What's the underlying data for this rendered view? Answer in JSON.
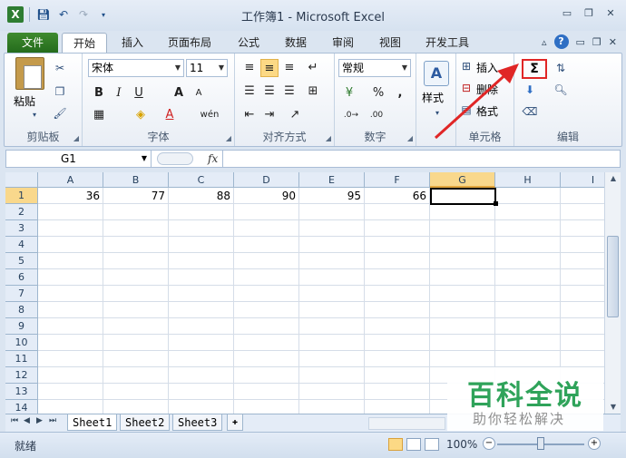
{
  "window": {
    "title": "工作簿1 - Microsoft Excel"
  },
  "ribbon_tabs": [
    {
      "label": "文件"
    },
    {
      "label": "开始"
    },
    {
      "label": "插入"
    },
    {
      "label": "页面布局"
    },
    {
      "label": "公式"
    },
    {
      "label": "数据"
    },
    {
      "label": "审阅"
    },
    {
      "label": "视图"
    },
    {
      "label": "开发工具"
    }
  ],
  "clipboard": {
    "paste_label": "粘贴",
    "group_label": "剪贴板"
  },
  "font": {
    "name": "宋体",
    "size": "11",
    "group_label": "字体",
    "bold": "B",
    "italic": "I",
    "underline": "U",
    "grow": "A",
    "shrink": "A",
    "font_color": "A",
    "phonetic": "wén"
  },
  "alignment": {
    "group_label": "对齐方式"
  },
  "number": {
    "format": "常规",
    "group_label": "数字",
    "percent": "%",
    "comma": ","
  },
  "styles": {
    "label": "样式"
  },
  "cells": {
    "insert": "插入",
    "delete": "删除",
    "format": "格式",
    "group_label": "单元格"
  },
  "editing": {
    "autosum": "Σ",
    "group_label": "编辑"
  },
  "formula_bar": {
    "name_box": "G1",
    "fx": "fx",
    "formula": ""
  },
  "columns": [
    "A",
    "B",
    "C",
    "D",
    "E",
    "F",
    "G",
    "H",
    "I"
  ],
  "rows": [
    "1",
    "2",
    "3",
    "4",
    "5",
    "6",
    "7",
    "8",
    "9",
    "10",
    "11",
    "12",
    "13",
    "14"
  ],
  "cells_data": {
    "row1": [
      "36",
      "77",
      "88",
      "90",
      "95",
      "66",
      ""
    ]
  },
  "active_cell": "G1",
  "sheet_tabs": [
    {
      "label": "Sheet1",
      "active": true
    },
    {
      "label": "Sheet2",
      "active": false
    },
    {
      "label": "Sheet3",
      "active": false
    }
  ],
  "status": {
    "mode": "就绪",
    "zoom": "100%"
  },
  "watermark": {
    "title": "百科全说",
    "subtitle": "助你轻松解决"
  },
  "colors": {
    "file_tab": "#2f7d24",
    "highlight_box": "#e02626",
    "arrow": "#e02626",
    "active_header": "#f9d88c",
    "watermark_green": "#2fa35a"
  }
}
